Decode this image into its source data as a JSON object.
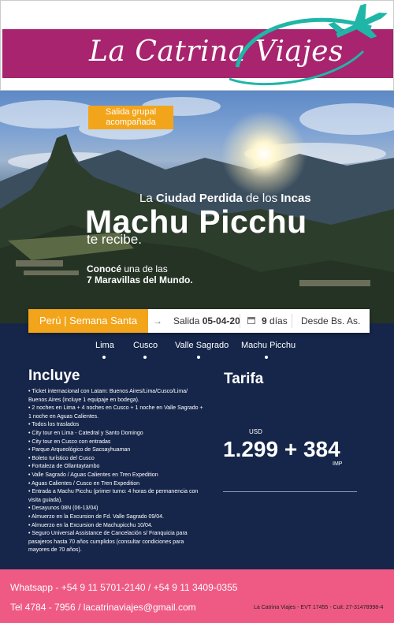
{
  "header": {
    "brand": "La Catrina Viajes",
    "accent_color": "#a8246f",
    "logo_icon": "airplane-swoosh-icon"
  },
  "hero": {
    "tag": "Salida grupal acompañada",
    "tagline_prefix": "La ",
    "tagline_strong": "Ciudad Perdida",
    "tagline_mid": " de los ",
    "tagline_strong2": "Incas",
    "title": "Machu Picchu",
    "subtitle": "te recibe.",
    "note_a": "Conocé",
    "note_b": " una de las",
    "note_c": "7 Maravillas del Mundo."
  },
  "trip": {
    "destination": "Perú | Semana Santa",
    "departure_label": "Salida ",
    "departure_date": "05-04-20",
    "days_number": "9",
    "days_label": " días",
    "origin": "Desde Bs. As."
  },
  "route": [
    "Lima",
    "Cusco",
    "Valle Sagrado",
    "Machu Picchu"
  ],
  "includes": {
    "title": "Incluye",
    "items": [
      "• Ticket internacional con Latam: Buenos Aires/Lima/Cusco/Lima/ Buenos Aires (incluye 1 equipaje en bodega).",
      "• 2 noches en Lima + 4 noches en Cusco + 1 noche en Valle Sagrado + 1 noche en Aguas Calientes.",
      "• Todos los traslados",
      "• City tour en Lima - Catedral y Santo Domingo",
      "• City tour en Cusco con entradas",
      "• Parque Arqueológico de Sacsayhuaman",
      "• Boleto turístico del Cusco",
      "• Fortaleza de Ollantaytambo",
      "• Valle Sagrado / Aguas Calientes en Tren Expedition",
      "• Aguas Calientes / Cusco en Tren Expedition",
      "• Entrada a Machu Picchu (primer turno: 4 horas de permanencia con visita guiada).",
      "• Desayunos 08N (06-13/04)",
      "• Almuerzo en la Excursion de Fd. Valle Sagrado 09/04.",
      "• Almuerzo en la Excursion de Machupicchu 10/04.",
      "• Seguro Universal Assistance de Cancelación s/ Franquicia para pasajeros hasta 70 años cumplidos (consultar condiciones para mayores de 70 años)."
    ]
  },
  "tarifa": {
    "title": "Tarifa",
    "currency": "USD",
    "price": "1.299 + 384",
    "tax_label": "IMP"
  },
  "footer": {
    "whatsapp": "Whatsapp - +54 9 11 5701-2140 / +54 9 11 3409-0355",
    "contact": "Tel 4784 - 7956 / lacatrinaviajes@gmail.com",
    "legal": "La Catrina Viajes - EVT 17455 - Cuit: 27-31478998-4",
    "color": "#ef5a84"
  }
}
